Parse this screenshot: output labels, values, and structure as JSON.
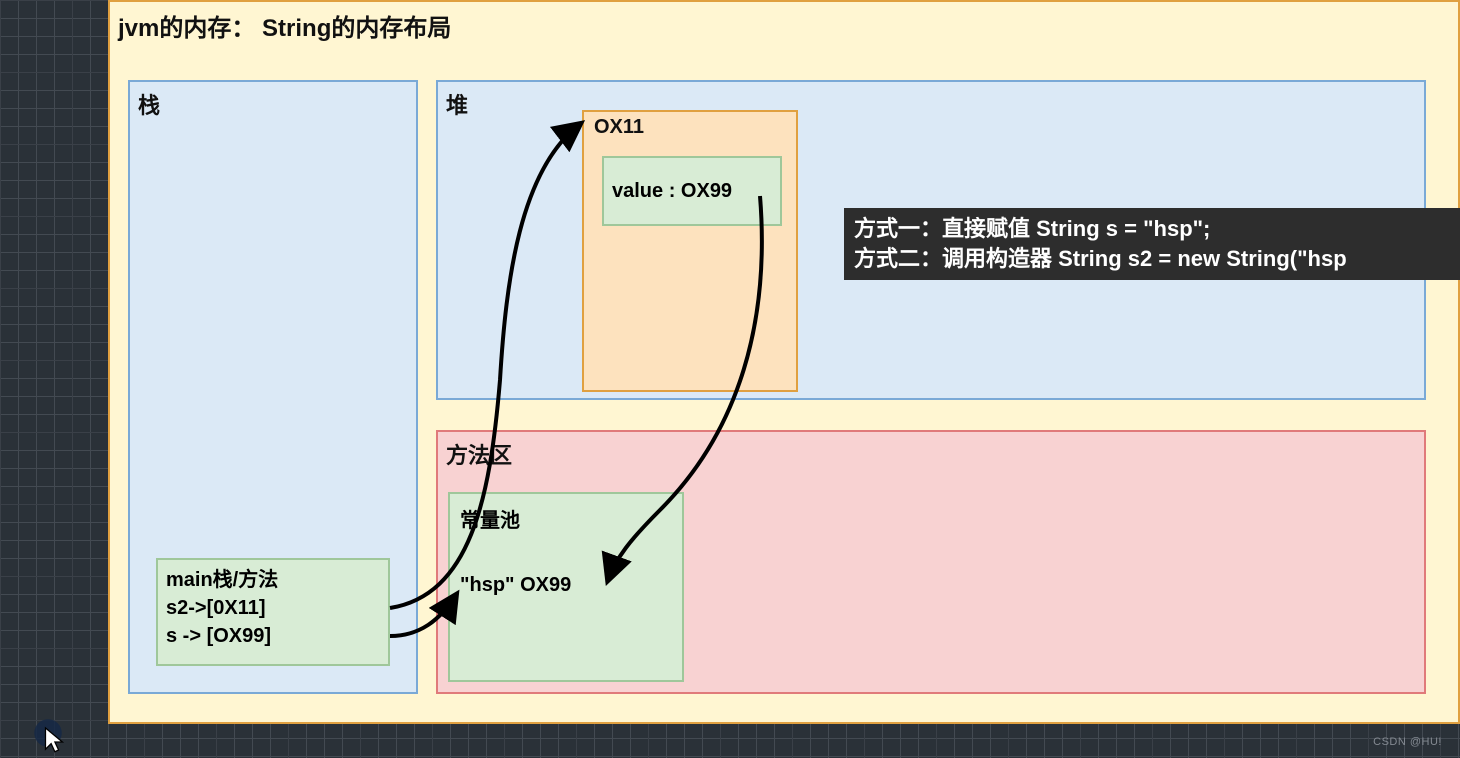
{
  "title": "jvm的内存：  String的内存布局",
  "regions": {
    "stack": "栈",
    "heap": "堆",
    "method_area": "方法区"
  },
  "heap_object": {
    "addr": "OX11",
    "field": "value : OX99"
  },
  "constant_pool": {
    "label": "常量池",
    "entry": "\"hsp\" OX99"
  },
  "main_frame": {
    "title": "main栈/方法",
    "s2": "s2->[0X11]",
    "s": "s -> [OX99]"
  },
  "annotation": {
    "line1": "方式一：直接赋值 String s = \"hsp\";",
    "line2": "方式二：调用构造器 String s2 = new String(\"hsp"
  },
  "watermark": "CSDN @HU!"
}
